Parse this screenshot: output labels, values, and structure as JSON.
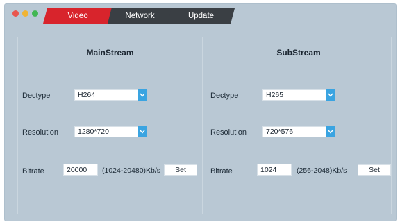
{
  "tabs": [
    {
      "label": "Video",
      "active": true
    },
    {
      "label": "Network",
      "active": false
    },
    {
      "label": "Update",
      "active": false
    }
  ],
  "colors": {
    "active_tab": "#d8242c",
    "inactive_tab": "#3a3f44",
    "window_bg": "#b9c8d4",
    "dropdown_arrow": "#3aa4e1"
  },
  "main_stream": {
    "title": "MainStream",
    "dectype_label": "Dectype",
    "dectype_value": "H264",
    "resolution_label": "Resolution",
    "resolution_value": "1280*720",
    "bitrate_label": "Bitrate",
    "bitrate_value": "20000",
    "bitrate_range": "(1024-20480)Kb/s",
    "set_label": "Set"
  },
  "sub_stream": {
    "title": "SubStream",
    "dectype_label": "Dectype",
    "dectype_value": "H265",
    "resolution_label": "Resolution",
    "resolution_value": "720*576",
    "bitrate_label": "Bitrate",
    "bitrate_value": "1024",
    "bitrate_range": "(256-2048)Kb/s",
    "set_label": "Set"
  }
}
